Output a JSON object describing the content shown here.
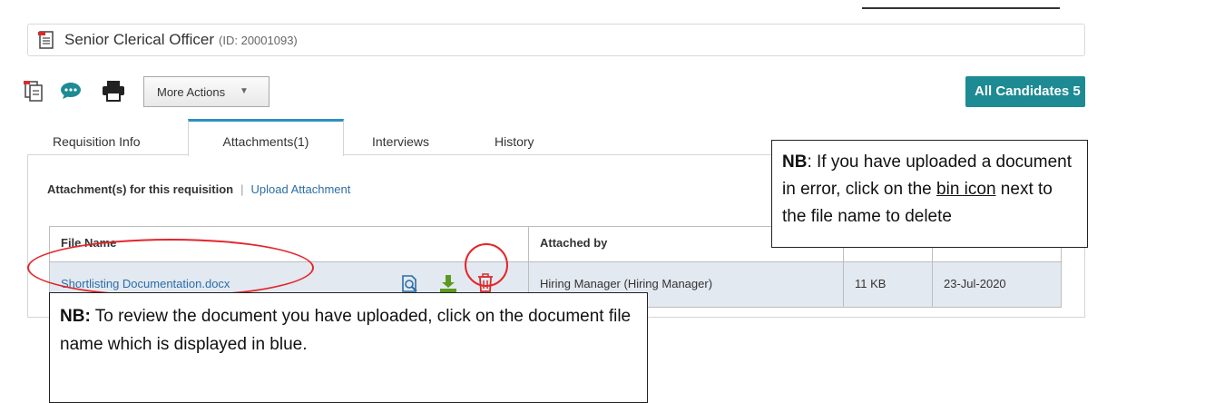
{
  "header": {
    "title": "Senior Clerical Officer",
    "req_id": "(ID: 20001093)"
  },
  "toolbar": {
    "more_actions_label": "More Actions",
    "all_candidates_label": "All Candidates 5"
  },
  "tabs": [
    {
      "label": "Requisition Info"
    },
    {
      "label": "Attachments(1)"
    },
    {
      "label": "Interviews"
    },
    {
      "label": "History"
    }
  ],
  "attachments": {
    "heading": "Attachment(s) for this requisition",
    "separator": "|",
    "upload_link": "Upload Attachment",
    "columns": [
      "File Name",
      "Attached by"
    ],
    "rows": [
      {
        "file_name": "Shortlisting Documentation.docx",
        "attached_by": "Hiring Manager (Hiring Manager)",
        "size": "11 KB",
        "date": "23-Jul-2020"
      }
    ]
  },
  "callouts": {
    "delete_note": {
      "nb": "NB",
      "text_1": ": If you have uploaded a document in error, click on the ",
      "underline": "bin icon",
      "text_2": " next to the file name to delete"
    },
    "review_note": {
      "nb": "NB:",
      "text": " To review the document you have uploaded, click on the document file name which is displayed in blue."
    }
  },
  "colors": {
    "accent_teal": "#1d8a94",
    "link_blue": "#2b6da8",
    "row_highlight": "#e3e9f0",
    "annotation_red": "#e3262b",
    "download_green": "#5a9a1e"
  }
}
